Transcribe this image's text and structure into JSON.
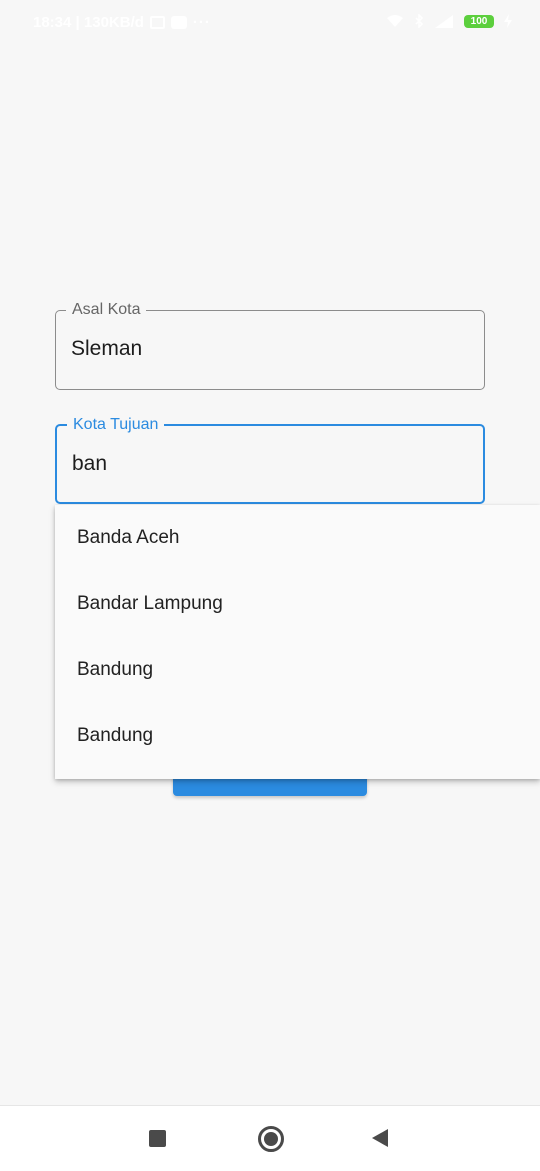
{
  "status_bar": {
    "time_and_speed": "18:34 | 130KB/d",
    "more_indicator": "···",
    "battery_level": "100"
  },
  "form": {
    "origin": {
      "label": "Asal Kota",
      "value": "Sleman"
    },
    "destination": {
      "label": "Kota Tujuan",
      "value": "ban"
    }
  },
  "suggestions": [
    "Banda Aceh",
    "Bandar Lampung",
    "Bandung",
    "Bandung"
  ],
  "colors": {
    "accent": "#2b8be0",
    "battery": "#5ccf3d",
    "background": "#f7f7f7"
  },
  "icons": {
    "status": [
      "message-icon",
      "gallery-icon",
      "wifi-icon",
      "bluetooth-icon",
      "signal-icon",
      "battery-icon",
      "charging-icon"
    ],
    "nav": [
      "recents-icon",
      "home-icon",
      "back-icon"
    ]
  }
}
